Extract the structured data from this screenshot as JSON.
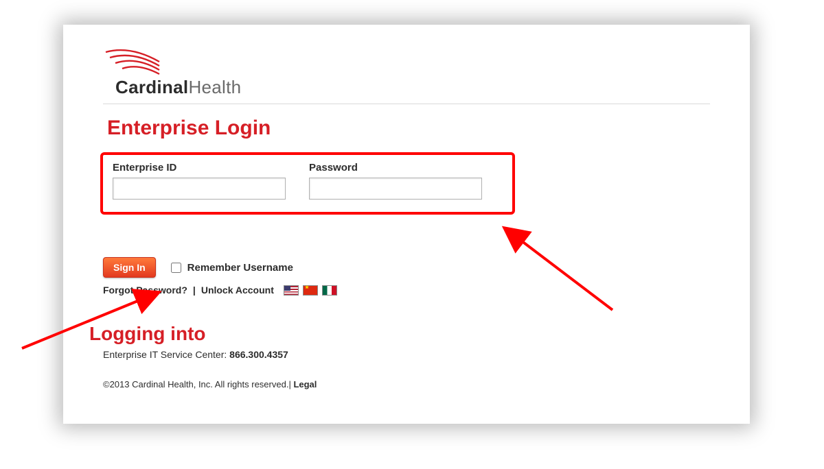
{
  "brand": {
    "name_bold": "Cardinal",
    "name_light": "Health"
  },
  "page": {
    "title": "Enterprise Login",
    "logging_into": "Logging into"
  },
  "fields": {
    "id_label": "Enterprise ID",
    "pw_label": "Password"
  },
  "actions": {
    "signin": "Sign In",
    "remember": "Remember Username",
    "forgot": "Forgot Password?",
    "unlock": "Unlock Account"
  },
  "flags": {
    "us": "United States",
    "cn": "China",
    "mx": "Mexico"
  },
  "svc": {
    "label": "Enterprise IT Service Center: ",
    "phone": "866.300.4357"
  },
  "footer": {
    "copyright": "©2013 Cardinal Health, Inc. All rights reserved.",
    "sep": "| ",
    "legal": "Legal"
  },
  "annotations": {
    "highlight_box": "red rectangle around Enterprise ID and Password inputs",
    "arrow_to_signin": "red arrow pointing at Sign In button from lower-left",
    "arrow_to_inputs": "red arrow pointing at highlighted input box from lower-right"
  }
}
